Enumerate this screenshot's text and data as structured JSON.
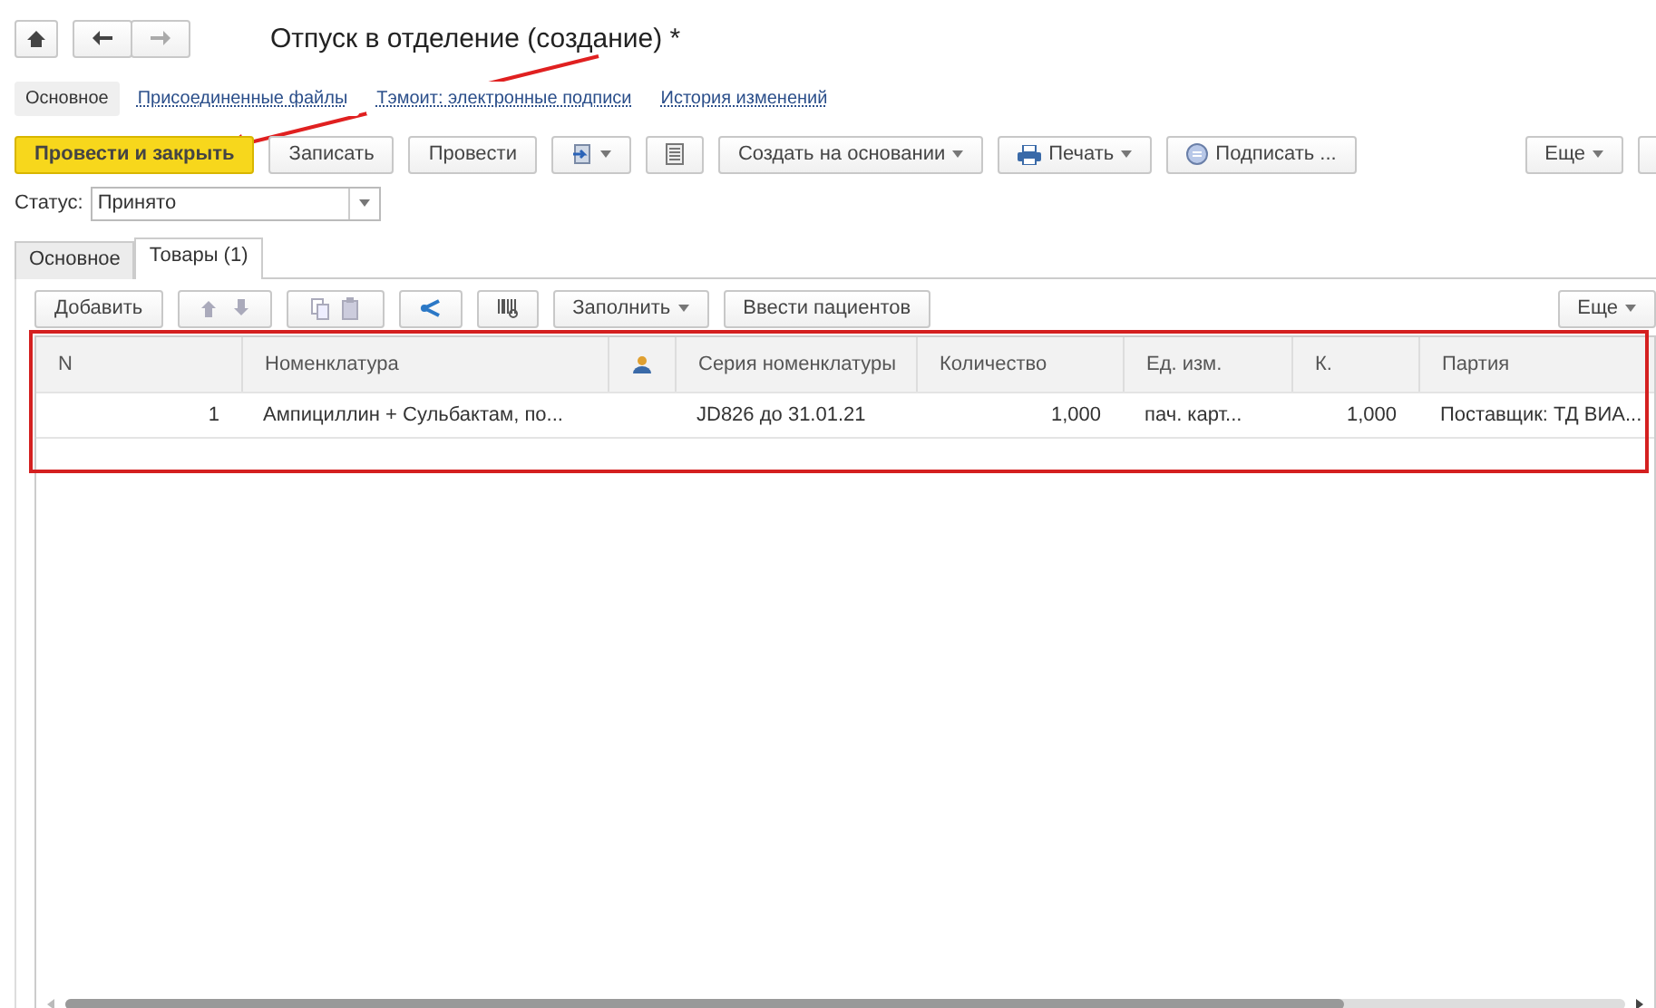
{
  "window": {
    "title": "Отпуск в отделение (создание) *"
  },
  "nav_links": [
    {
      "label": "Основное",
      "selected": true
    },
    {
      "label": "Присоединенные файлы",
      "selected": false
    },
    {
      "label": "Тэмоит: электронные подписи",
      "selected": false
    },
    {
      "label": "История изменений",
      "selected": false
    }
  ],
  "toolbar": [
    {
      "kind": "primary",
      "label": "Провести и закрыть"
    },
    {
      "kind": "plain",
      "label": "Записать"
    },
    {
      "kind": "plain",
      "label": "Провести"
    },
    {
      "kind": "import"
    },
    {
      "kind": "list"
    },
    {
      "kind": "menu",
      "label": "Создать на основании"
    },
    {
      "kind": "print",
      "label": "Печать"
    },
    {
      "kind": "sign",
      "label": "Подписать ..."
    },
    {
      "kind": "more",
      "label": "Еще"
    }
  ],
  "status": {
    "label": "Статус:",
    "value": "Принято"
  },
  "tabs": [
    {
      "label": "Основное",
      "selected": false
    },
    {
      "label": "Товары (1)",
      "selected": true
    }
  ],
  "table_toolbar": [
    {
      "kind": "plain",
      "label": "Добавить"
    },
    {
      "kind": "arrows"
    },
    {
      "kind": "copy"
    },
    {
      "kind": "share"
    },
    {
      "kind": "barcode"
    },
    {
      "kind": "menu",
      "label": "Заполнить"
    },
    {
      "kind": "plain",
      "label": "Ввести пациентов"
    },
    {
      "kind": "more",
      "label": "Еще"
    }
  ],
  "table": {
    "columns": [
      {
        "label": "N"
      },
      {
        "label": "Номенклатура"
      },
      {
        "kind": "icon"
      },
      {
        "label": "Серия номенклатуры"
      },
      {
        "label": "Количество"
      },
      {
        "label": "Ед. изм."
      },
      {
        "label": "К."
      },
      {
        "label": "Партия"
      }
    ],
    "rows": [
      {
        "cells": [
          "1",
          "Ампициллин + Сульбактам, по...",
          "",
          "JD826 до 31.01.21",
          "1,000",
          "пач. карт...",
          "1,000",
          "Поставщик: ТД ВИА..."
        ]
      }
    ]
  }
}
